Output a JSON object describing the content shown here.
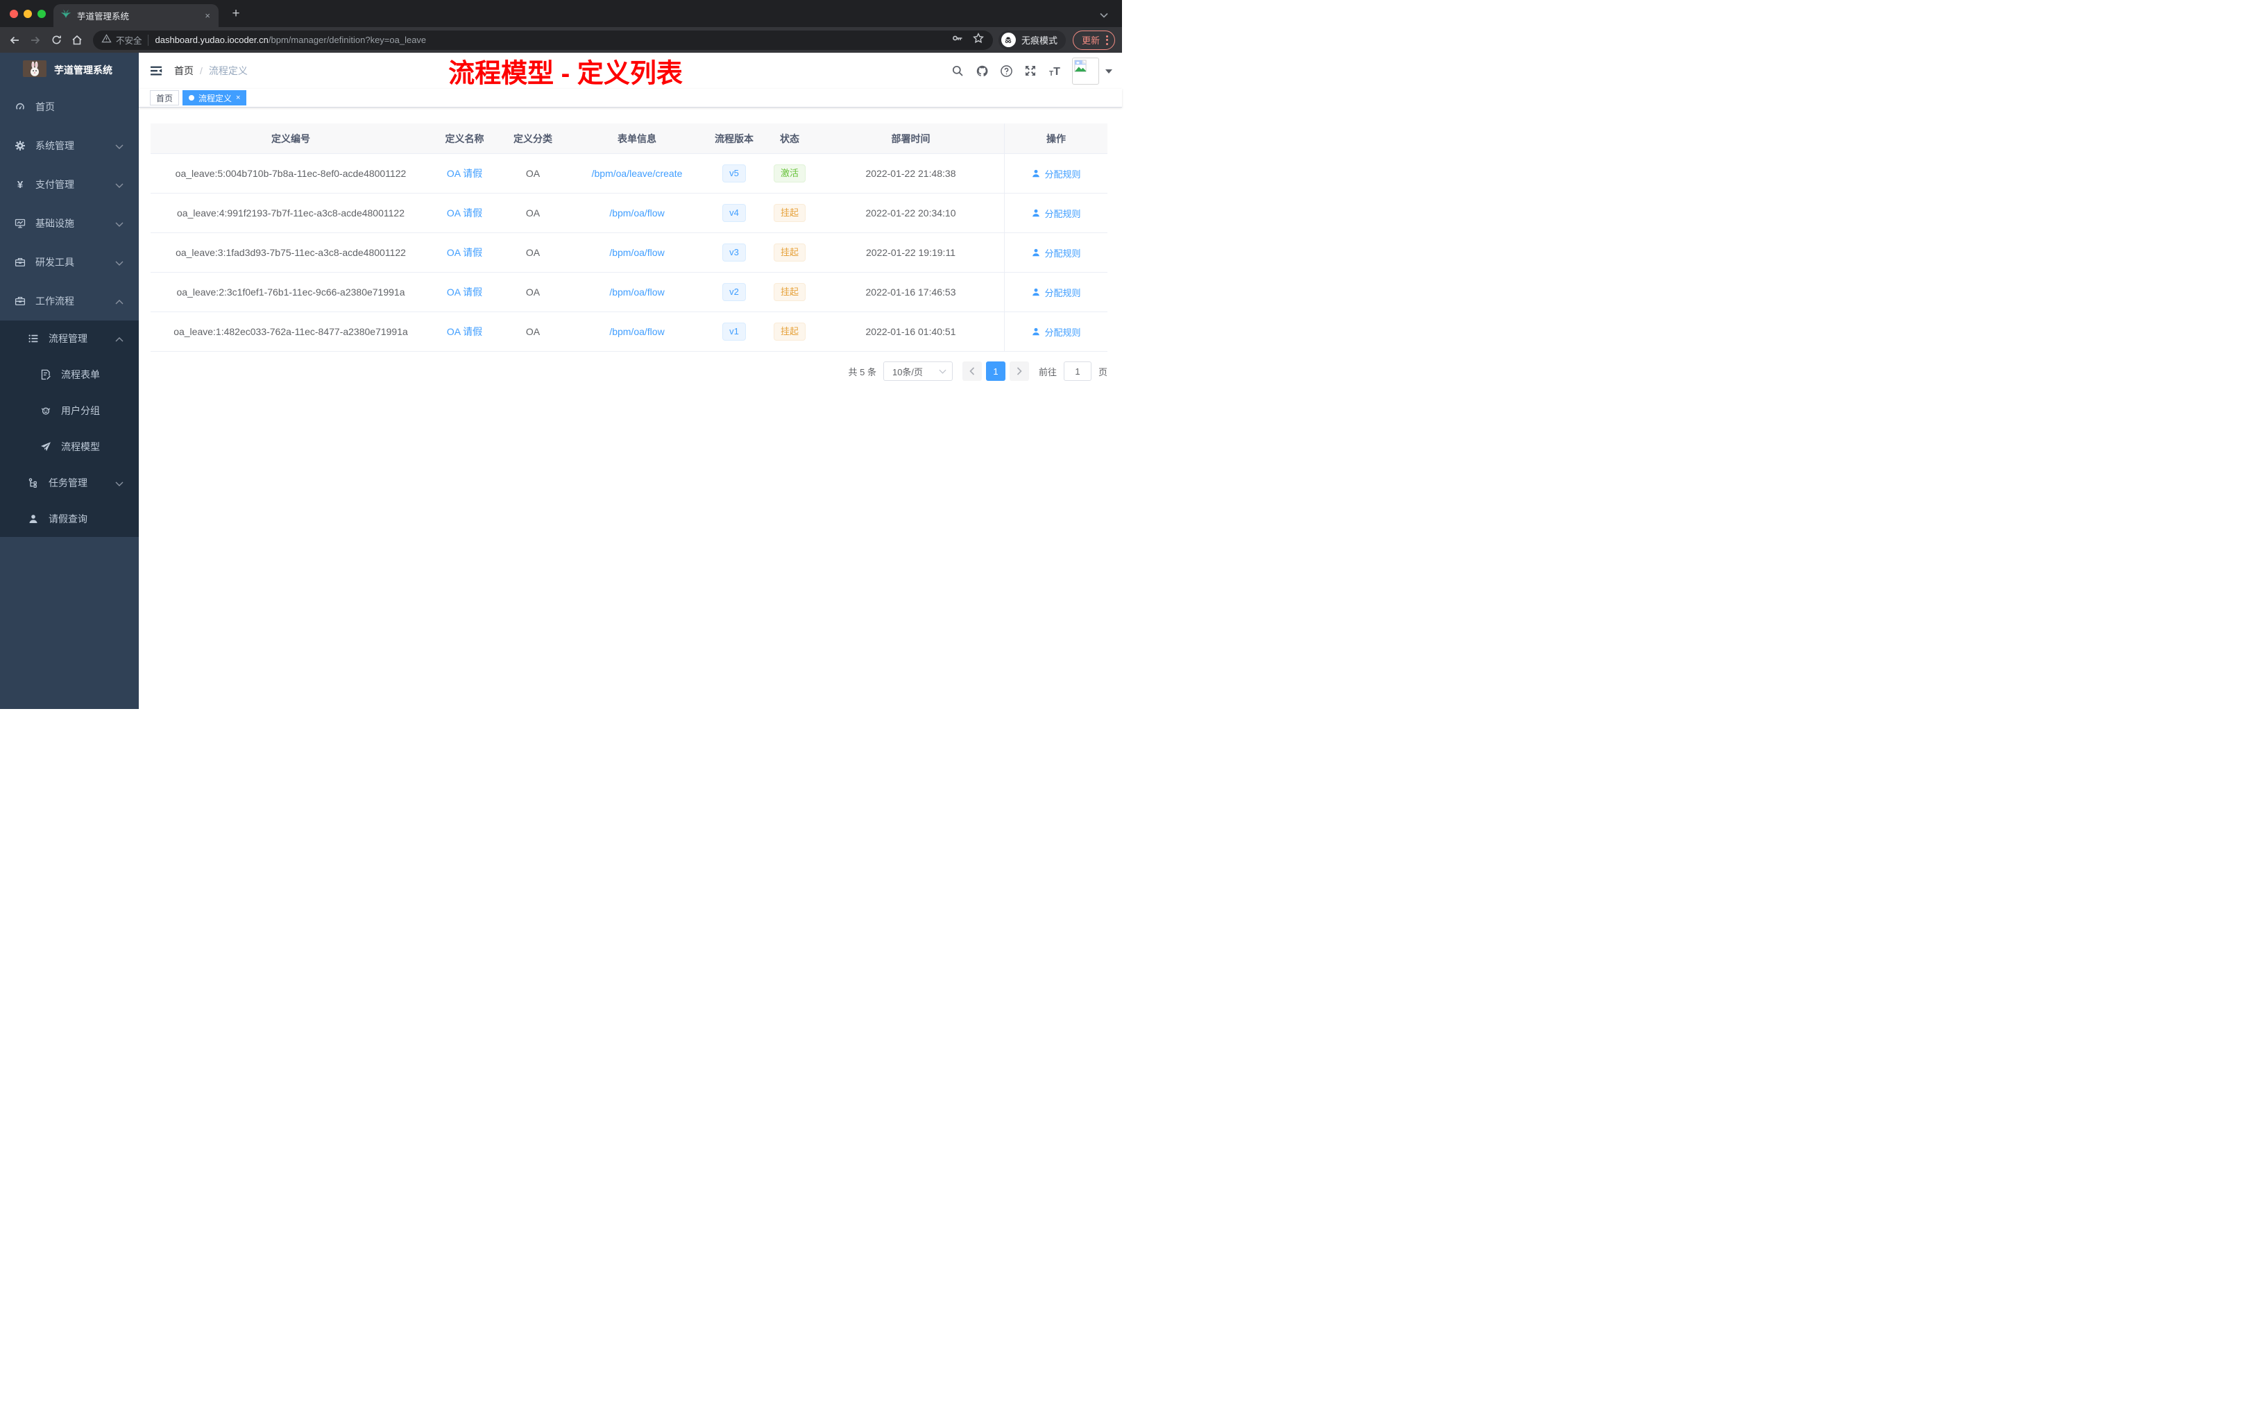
{
  "colors": {
    "accent": "#409eff",
    "annotation_red": "#fe0000",
    "status_active": "#67c23a",
    "status_suspended": "#e6a23c",
    "sidebar_bg": "#304156",
    "sidebar_panel_bg": "#1f2d3d"
  },
  "browser": {
    "tab_title": "芋道管理系统",
    "tab_close_glyph": "×",
    "security_label": "不安全",
    "url_host": "dashboard.yudao.iocoder.cn",
    "url_path": "/bpm/manager/definition?key=oa_leave",
    "incognito_label": "无痕模式",
    "update_label": "更新"
  },
  "sidebar": {
    "title": "芋道管理系统",
    "items": [
      {
        "key": "home",
        "label": "首页",
        "icon": "dashboard-icon",
        "level": 1,
        "panel": false,
        "chevron": null
      },
      {
        "key": "system-mgmt",
        "label": "系统管理",
        "icon": "gear-icon",
        "level": 1,
        "panel": false,
        "chevron": "down"
      },
      {
        "key": "payment-mgmt",
        "label": "支付管理",
        "icon": "yen-icon",
        "level": 1,
        "panel": false,
        "chevron": "down"
      },
      {
        "key": "infrastructure",
        "label": "基础设施",
        "icon": "monitor-icon",
        "level": 1,
        "panel": false,
        "chevron": "down"
      },
      {
        "key": "dev-tools",
        "label": "研发工具",
        "icon": "toolbox-icon",
        "level": 1,
        "panel": false,
        "chevron": "down"
      },
      {
        "key": "workflow",
        "label": "工作流程",
        "icon": "briefcase-icon",
        "level": 1,
        "panel": false,
        "chevron": "up"
      },
      {
        "key": "process-mgmt",
        "label": "流程管理",
        "icon": "list-icon",
        "level": 2,
        "panel": true,
        "chevron": "up"
      },
      {
        "key": "process-form",
        "label": "流程表单",
        "icon": "form-icon",
        "level": 3,
        "panel": true,
        "chevron": null
      },
      {
        "key": "user-group",
        "label": "用户分组",
        "icon": "usergroup-icon",
        "level": 3,
        "panel": true,
        "chevron": null
      },
      {
        "key": "process-model",
        "label": "流程模型",
        "icon": "plane-icon",
        "level": 3,
        "panel": true,
        "chevron": null
      },
      {
        "key": "task-mgmt",
        "label": "任务管理",
        "icon": "tree-icon",
        "level": 2,
        "panel": true,
        "chevron": "down"
      },
      {
        "key": "leave-query",
        "label": "请假查询",
        "icon": "user-icon",
        "level": 2,
        "panel": true,
        "chevron": null
      }
    ]
  },
  "header": {
    "breadcrumb_home": "首页",
    "breadcrumb_separator": "/",
    "breadcrumb_current": "流程定义",
    "annotation": "流程模型 - 定义列表"
  },
  "tags": {
    "close_glyph": "×",
    "items": [
      {
        "label": "首页",
        "active": false
      },
      {
        "label": "流程定义",
        "active": true
      }
    ]
  },
  "table": {
    "columns": [
      "定义编号",
      "定义名称",
      "定义分类",
      "表单信息",
      "流程版本",
      "状态",
      "部署时间",
      "操作"
    ],
    "rows": [
      {
        "id": "oa_leave:5:004b710b-7b8a-11ec-8ef0-acde48001122",
        "name": "OA 请假",
        "category": "OA",
        "form": "/bpm/oa/leave/create",
        "version": "v5",
        "status": "激活",
        "status_type": "success",
        "time": "2022-01-22 21:48:38",
        "action": "分配规则"
      },
      {
        "id": "oa_leave:4:991f2193-7b7f-11ec-a3c8-acde48001122",
        "name": "OA 请假",
        "category": "OA",
        "form": "/bpm/oa/flow",
        "version": "v4",
        "status": "挂起",
        "status_type": "warning",
        "time": "2022-01-22 20:34:10",
        "action": "分配规则"
      },
      {
        "id": "oa_leave:3:1fad3d93-7b75-11ec-a3c8-acde48001122",
        "name": "OA 请假",
        "category": "OA",
        "form": "/bpm/oa/flow",
        "version": "v3",
        "status": "挂起",
        "status_type": "warning",
        "time": "2022-01-22 19:19:11",
        "action": "分配规则"
      },
      {
        "id": "oa_leave:2:3c1f0ef1-76b1-11ec-9c66-a2380e71991a",
        "name": "OA 请假",
        "category": "OA",
        "form": "/bpm/oa/flow",
        "version": "v2",
        "status": "挂起",
        "status_type": "warning",
        "time": "2022-01-16 17:46:53",
        "action": "分配规则"
      },
      {
        "id": "oa_leave:1:482ec033-762a-11ec-8477-a2380e71991a",
        "name": "OA 请假",
        "category": "OA",
        "form": "/bpm/oa/flow",
        "version": "v1",
        "status": "挂起",
        "status_type": "warning",
        "time": "2022-01-16 01:40:51",
        "action": "分配规则"
      }
    ]
  },
  "pagination": {
    "total_label": "共 5 条",
    "page_size_label": "10条/页",
    "current_page": "1",
    "goto_label": "前往",
    "goto_value": "1",
    "page_unit": "页"
  }
}
